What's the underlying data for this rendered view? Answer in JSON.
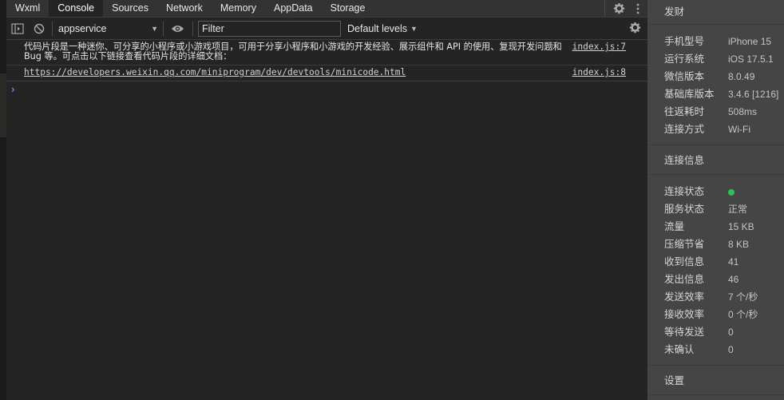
{
  "tabs": [
    "Wxml",
    "Console",
    "Sources",
    "Network",
    "Memory",
    "AppData",
    "Storage"
  ],
  "toolbar": {
    "context": "appservice",
    "filter_placeholder": "Filter",
    "levels": "Default levels"
  },
  "console": {
    "messages": [
      {
        "text": "代码片段是一种迷你、可分享的小程序或小游戏项目，可用于分享小程序和小游戏的开发经验、展示组件和 API 的使用、复现开发问题和 Bug 等。可点击以下链接查看代码片段的详细文档：",
        "source": "index.js:7"
      },
      {
        "link": "https://developers.weixin.qq.com/miniprogram/dev/devtools/minicode.html",
        "source": "index.js:8"
      }
    ],
    "prompt": "›"
  },
  "sidebar": {
    "title": "发财",
    "device": [
      {
        "k": "手机型号",
        "v": "iPhone 15"
      },
      {
        "k": "运行系统",
        "v": "iOS 17.5.1"
      },
      {
        "k": "微信版本",
        "v": "8.0.49"
      },
      {
        "k": "基础库版本",
        "v": "3.4.6 [1216]"
      },
      {
        "k": "往返耗时",
        "v": "508ms"
      },
      {
        "k": "连接方式",
        "v": "Wi-Fi"
      }
    ],
    "conn_title": "连接信息",
    "conn_status_label": "连接状态",
    "status_color": "#2bc15a",
    "conn": [
      {
        "k": "服务状态",
        "v": "正常"
      },
      {
        "k": "流量",
        "v": "15 KB"
      },
      {
        "k": "压缩节省",
        "v": "8 KB"
      },
      {
        "k": "收到信息",
        "v": "41"
      },
      {
        "k": "发出信息",
        "v": "46"
      },
      {
        "k": "发送效率",
        "v": "7 个/秒"
      },
      {
        "k": "接收效率",
        "v": "0 个/秒"
      },
      {
        "k": "等待发送",
        "v": "0"
      },
      {
        "k": "未确认",
        "v": "0"
      }
    ],
    "settings": "设置"
  }
}
